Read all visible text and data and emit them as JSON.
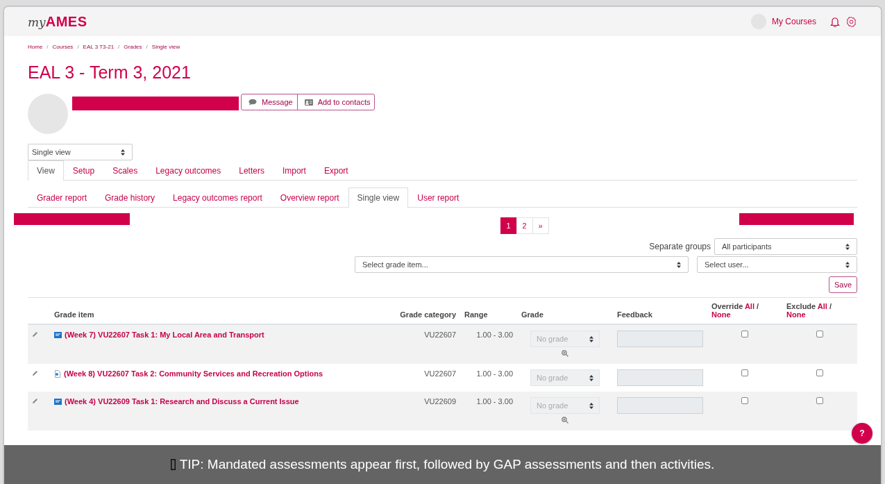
{
  "header": {
    "logo_prefix": "my",
    "logo_brand": "AMES",
    "my_courses": "My Courses"
  },
  "breadcrumb": [
    "Home",
    "Courses",
    "EAL 3 T3-21",
    "Grades",
    "Single view"
  ],
  "breadcrumb_separator": "/",
  "help": "?",
  "title": "EAL 3 - Term 3, 2021",
  "profile_buttons": [
    {
      "kind": "message",
      "label": "Message"
    },
    {
      "kind": "contact",
      "label": "Add to contacts"
    }
  ],
  "view_select": "Single view",
  "tabs": [
    {
      "label": "View",
      "selected": true
    },
    {
      "label": "Setup",
      "selected": false
    },
    {
      "label": "Scales",
      "selected": false
    },
    {
      "label": "Legacy outcomes",
      "selected": false
    },
    {
      "label": "Letters",
      "selected": false
    },
    {
      "label": "Import",
      "selected": false
    },
    {
      "label": "Export",
      "selected": false
    }
  ],
  "subtabs": [
    {
      "label": "Grader report",
      "selected": false
    },
    {
      "label": "Grade history",
      "selected": false
    },
    {
      "label": "Legacy outcomes report",
      "selected": false
    },
    {
      "label": "Overview report",
      "selected": false
    },
    {
      "label": "Single view",
      "selected": true
    },
    {
      "label": "User report",
      "selected": false
    }
  ],
  "pagination": [
    {
      "label": "1",
      "selected": true
    },
    {
      "label": "2",
      "selected": false
    },
    {
      "label": "»",
      "selected": false
    }
  ],
  "groups": {
    "label": "Separate groups",
    "value": "All participants"
  },
  "grade_item_select": "Select grade item...",
  "user_select": "Select user...",
  "save": "Save",
  "table": {
    "columns": [
      "Grade item",
      "Grade category",
      "Range",
      "Grade",
      "Feedback"
    ],
    "toggle_columns": [
      {
        "label": "Override",
        "all": "All",
        "separator": "/",
        "none": "None"
      },
      {
        "label": "Exclude",
        "all": "All",
        "separator": "/",
        "none": "None"
      }
    ],
    "rows": [
      {
        "kind": "assignment",
        "item": "(Week 7) VU22607 Task 1: My Local Area and Transport",
        "category": "VU22607",
        "range": "1.00 - 3.00",
        "grade": "No grade",
        "analysis": true,
        "override": false,
        "exclude": false
      },
      {
        "kind": "quiz",
        "item": "(Week 8) VU22607 Task 2: Community Services and Recreation Options",
        "category": "VU22607",
        "range": "1.00 - 3.00",
        "grade": "No grade",
        "analysis": false,
        "override": false,
        "exclude": false
      },
      {
        "kind": "assignment",
        "item": "(Week 4) VU22609 Task 1: Research and Discuss a Current Issue",
        "category": "VU22609",
        "range": "1.00 - 3.00",
        "grade": "No grade",
        "analysis": true,
        "override": false,
        "exclude": false
      }
    ]
  },
  "tip": "TIP: Mandated assessments appear first, followed by GAP assessments and then activities."
}
